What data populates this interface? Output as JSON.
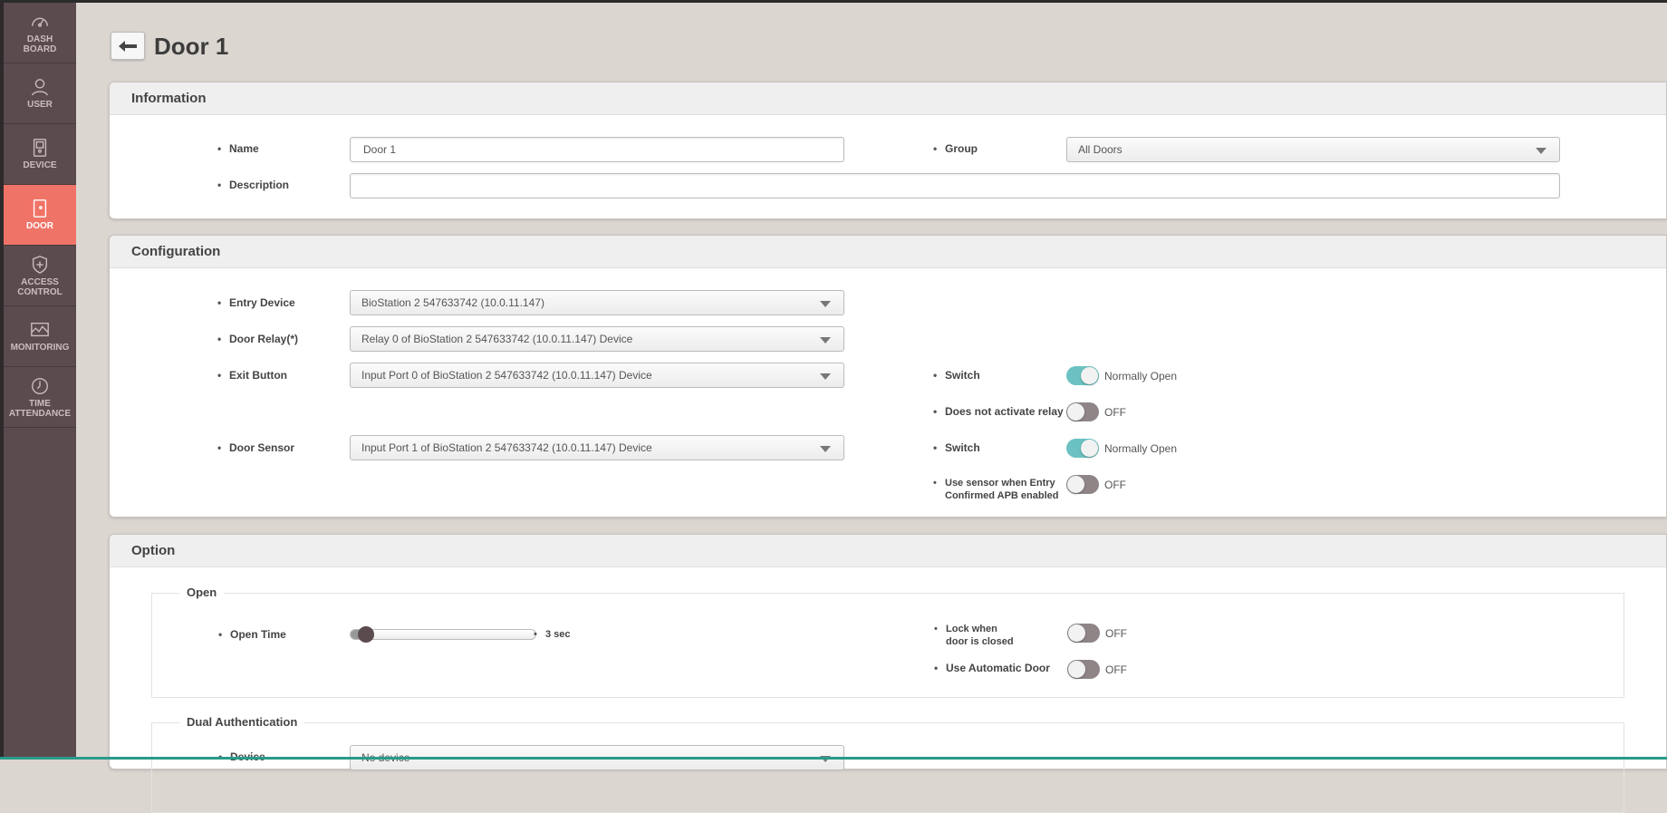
{
  "sidebar": {
    "items": [
      {
        "label": "DASH BOARD",
        "icon": "gauge-icon"
      },
      {
        "label": "USER",
        "icon": "user-icon"
      },
      {
        "label": "DEVICE",
        "icon": "device-icon"
      },
      {
        "label": "DOOR",
        "icon": "door-icon",
        "active": true
      },
      {
        "label": "ACCESS CONTROL",
        "icon": "shield-plus-icon"
      },
      {
        "label": "MONITORING",
        "icon": "monitor-icon"
      },
      {
        "label": "TIME ATTENDANCE",
        "icon": "clock-icon"
      }
    ]
  },
  "page": {
    "title": "Door 1"
  },
  "information": {
    "title": "Information",
    "name_label": "Name",
    "name_value": "Door 1",
    "group_label": "Group",
    "group_value": "All Doors",
    "description_label": "Description",
    "description_value": ""
  },
  "configuration": {
    "title": "Configuration",
    "entry_device_label": "Entry Device",
    "entry_device_value": "BioStation 2 547633742 (10.0.11.147)",
    "door_relay_label": "Door Relay(*)",
    "door_relay_value": "Relay 0 of BioStation 2 547633742 (10.0.11.147) Device",
    "exit_button_label": "Exit Button",
    "exit_button_value": "Input Port 0 of BioStation 2 547633742 (10.0.11.147) Device",
    "door_sensor_label": "Door Sensor",
    "door_sensor_value": "Input Port 1 of BioStation 2 547633742 (10.0.11.147) Device",
    "exit_switch_label": "Switch",
    "exit_switch_state": "Normally Open",
    "no_relay_label": "Does not activate relay",
    "no_relay_state": "OFF",
    "sensor_switch_label": "Switch",
    "sensor_switch_state": "Normally Open",
    "apb_label_1": "Use sensor when Entry",
    "apb_label_2": "Confirmed APB enabled",
    "apb_state": "OFF"
  },
  "option": {
    "title": "Option",
    "open": {
      "legend": "Open",
      "open_time_label": "Open Time",
      "open_time_value": "3 sec",
      "open_time_fraction": 0.03,
      "lock_label_1": "Lock when",
      "lock_label_2": "door is closed",
      "lock_state": "OFF",
      "auto_door_label": "Use Automatic Door",
      "auto_door_state": "OFF"
    },
    "dual": {
      "legend": "Dual Authentication",
      "device_label": "Device",
      "device_value": "No device"
    }
  }
}
